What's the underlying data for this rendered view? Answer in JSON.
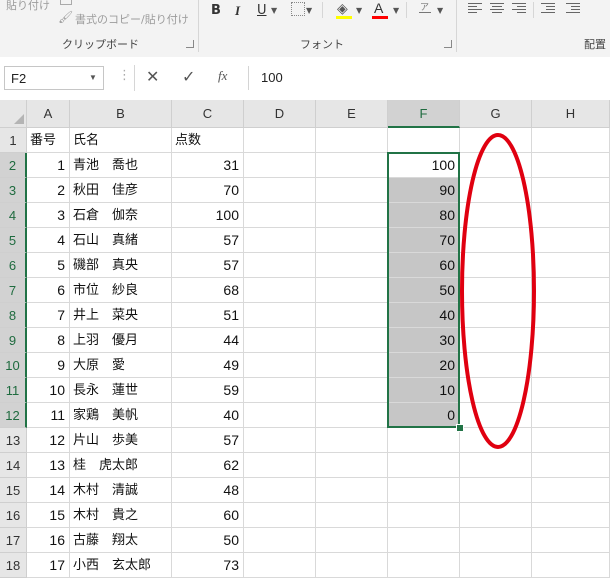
{
  "ribbon": {
    "paste_label": "貼り付け",
    "copy_format_label": "書式のコピー/貼り付け",
    "clipboard_group": "クリップボード",
    "bold": "B",
    "italic": "I",
    "underline": "U",
    "font_color_glyph": "A",
    "font_group": "フォント",
    "phonetic_glyph": "ア",
    "alignment_group": "配置",
    "colors": {
      "font_color": "#ff0000"
    }
  },
  "formula_bar": {
    "name_box": "F2",
    "cancel_icon": "✕",
    "enter_icon": "✓",
    "fx_label": "fx",
    "formula_value": "100"
  },
  "grid": {
    "columns": [
      "A",
      "B",
      "C",
      "D",
      "E",
      "F",
      "G",
      "H"
    ],
    "selected_column": "F",
    "rows": [
      {
        "r": "1",
        "a": "番号",
        "b": "氏名",
        "c": "点数",
        "f": ""
      },
      {
        "r": "2",
        "a": "1",
        "b": "青池　喬也",
        "c": "31",
        "f": "100"
      },
      {
        "r": "3",
        "a": "2",
        "b": "秋田　佳彦",
        "c": "70",
        "f": "90"
      },
      {
        "r": "4",
        "a": "3",
        "b": "石倉　伽奈",
        "c": "100",
        "f": "80"
      },
      {
        "r": "5",
        "a": "4",
        "b": "石山　真緒",
        "c": "57",
        "f": "70"
      },
      {
        "r": "6",
        "a": "5",
        "b": "磯部　真央",
        "c": "57",
        "f": "60"
      },
      {
        "r": "7",
        "a": "6",
        "b": "市位　紗良",
        "c": "68",
        "f": "50"
      },
      {
        "r": "8",
        "a": "7",
        "b": "井上　菜央",
        "c": "51",
        "f": "40"
      },
      {
        "r": "9",
        "a": "8",
        "b": "上羽　優月",
        "c": "44",
        "f": "30"
      },
      {
        "r": "10",
        "a": "9",
        "b": "大原　愛",
        "c": "49",
        "f": "20"
      },
      {
        "r": "11",
        "a": "10",
        "b": "長永　蓮世",
        "c": "59",
        "f": "10"
      },
      {
        "r": "12",
        "a": "11",
        "b": "家鶏　美帆",
        "c": "40",
        "f": "0"
      },
      {
        "r": "13",
        "a": "12",
        "b": "片山　歩美",
        "c": "57",
        "f": ""
      },
      {
        "r": "14",
        "a": "13",
        "b": "桂　虎太郎",
        "c": "62",
        "f": ""
      },
      {
        "r": "15",
        "a": "14",
        "b": "木村　清誠",
        "c": "48",
        "f": ""
      },
      {
        "r": "16",
        "a": "15",
        "b": "木村　貴之",
        "c": "60",
        "f": ""
      },
      {
        "r": "17",
        "a": "16",
        "b": "古藤　翔太",
        "c": "50",
        "f": ""
      },
      {
        "r": "18",
        "a": "17",
        "b": "小西　玄太郎",
        "c": "73",
        "f": ""
      }
    ]
  },
  "annotation": {
    "color": "#e00010"
  }
}
